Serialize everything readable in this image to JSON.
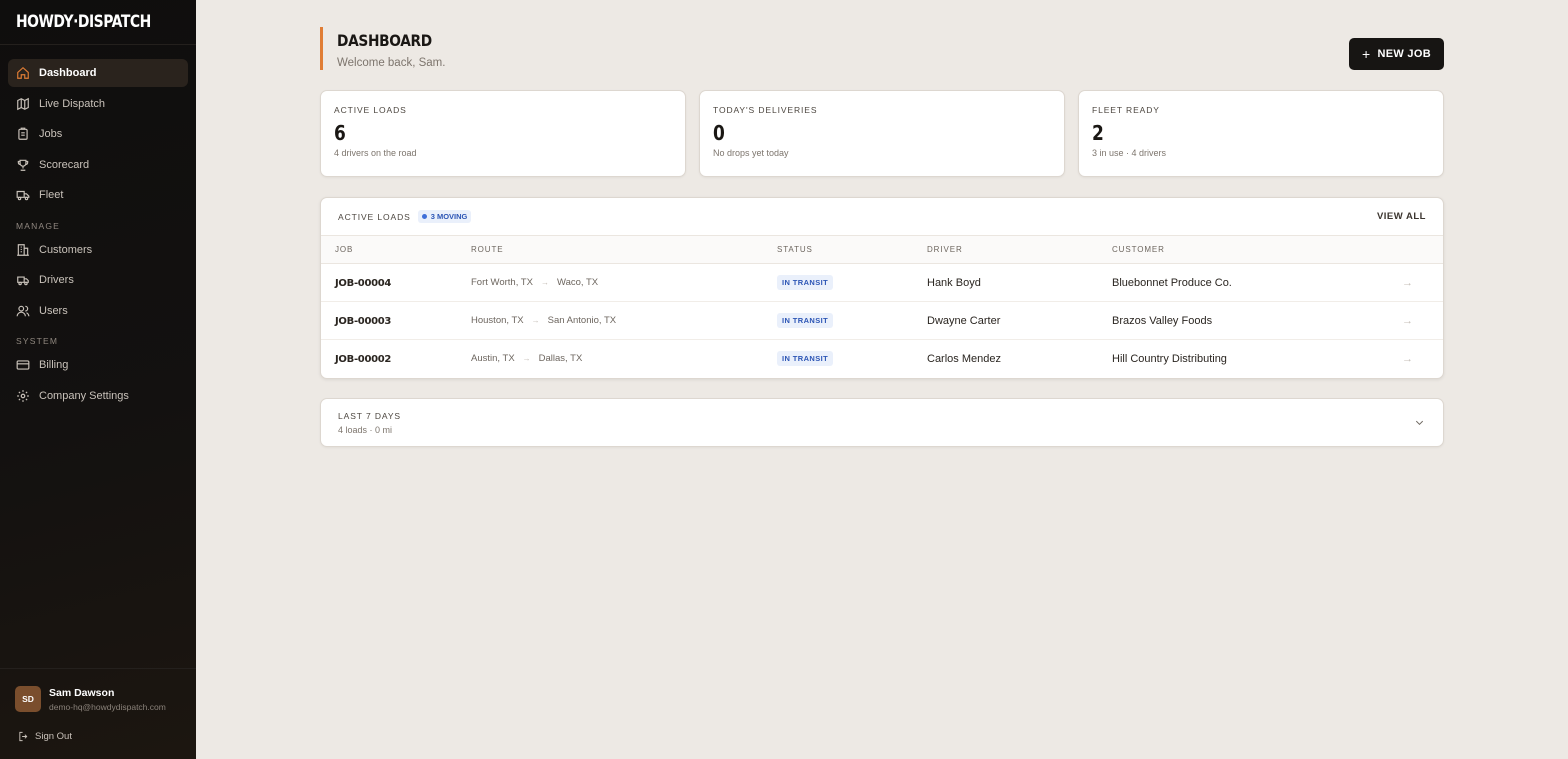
{
  "app": {
    "logo": "HOWDY·DISPATCH"
  },
  "sidebar": {
    "main_items": [
      {
        "label": "Dashboard",
        "icon": "home-icon",
        "active": true
      },
      {
        "label": "Live Dispatch",
        "icon": "map-icon"
      },
      {
        "label": "Jobs",
        "icon": "clipboard-icon"
      },
      {
        "label": "Scorecard",
        "icon": "trophy-icon"
      },
      {
        "label": "Fleet",
        "icon": "truck-icon"
      }
    ],
    "manage_label": "MANAGE",
    "manage_items": [
      {
        "label": "Customers",
        "icon": "building-icon"
      },
      {
        "label": "Drivers",
        "icon": "driver-icon"
      },
      {
        "label": "Users",
        "icon": "users-icon"
      }
    ],
    "system_label": "SYSTEM",
    "system_items": [
      {
        "label": "Billing",
        "icon": "credit-card-icon"
      },
      {
        "label": "Company Settings",
        "icon": "gear-icon"
      }
    ],
    "user": {
      "initials": "SD",
      "name": "Sam Dawson",
      "email": "demo-hq@howdydispatch.com"
    },
    "signout_label": "Sign Out"
  },
  "header": {
    "title": "DASHBOARD",
    "welcome": "Welcome back, Sam.",
    "new_job_label": "NEW JOB"
  },
  "stats": [
    {
      "label": "ACTIVE LOADS",
      "value": "6",
      "sub": "4 drivers on the road"
    },
    {
      "label": "TODAY'S DELIVERIES",
      "value": "0",
      "sub": "No drops yet today"
    },
    {
      "label": "FLEET READY",
      "value": "2",
      "sub": "3 in use · 4 drivers"
    }
  ],
  "active_loads": {
    "title": "ACTIVE LOADS",
    "badge": "3 MOVING",
    "view_all": "VIEW ALL",
    "columns": [
      "JOB",
      "ROUTE",
      "STATUS",
      "DRIVER",
      "CUSTOMER"
    ],
    "rows": [
      {
        "job": "JOB-00004",
        "from": "Fort Worth, TX",
        "to": "Waco, TX",
        "status": "IN TRANSIT",
        "driver": "Hank Boyd",
        "customer": "Bluebonnet Produce Co."
      },
      {
        "job": "JOB-00003",
        "from": "Houston, TX",
        "to": "San Antonio, TX",
        "status": "IN TRANSIT",
        "driver": "Dwayne Carter",
        "customer": "Brazos Valley Foods"
      },
      {
        "job": "JOB-00002",
        "from": "Austin, TX",
        "to": "Dallas, TX",
        "status": "IN TRANSIT",
        "driver": "Carlos Mendez",
        "customer": "Hill Country Distributing"
      }
    ]
  },
  "last7": {
    "title": "LAST 7 DAYS",
    "sub": "4 loads · 0 mi"
  },
  "colors": {
    "accent": "#e07d35",
    "status_blue": "#2c55b5",
    "sidebar_bg": "#0f0e0d",
    "page_bg": "#ede9e4"
  }
}
